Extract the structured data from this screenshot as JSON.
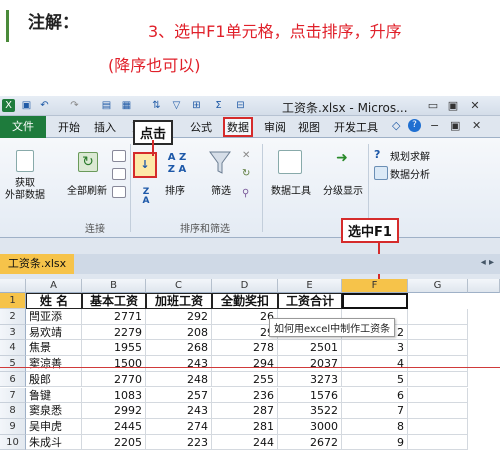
{
  "annotation": {
    "title": "注解：",
    "step_line1": "3、选中F1单元格，点击排序，升序",
    "step_line2": "(降序也可以)"
  },
  "window": {
    "title": "工资条.xlsx - Micros...",
    "controls": [
      "▭",
      "▣",
      "✕"
    ]
  },
  "ribbon_tabs": [
    "开始",
    "插入",
    "页",
    "公式",
    "数据",
    "审阅",
    "视图",
    "开发工具"
  ],
  "file_tab": "文件",
  "ribbon": {
    "groups": {
      "connections": "连接",
      "sort_filter": "排序和筛选"
    },
    "buttons": {
      "get_external": "获取\n外部数据",
      "refresh_all": "全部刷新",
      "sort": "排序",
      "filter": "筛选",
      "data_tools": "数据工具",
      "outline": "分级显示",
      "solver": "规划求解",
      "data_analysis": "数据分析"
    }
  },
  "callouts": {
    "click": "点击",
    "select_f1": "选中F1"
  },
  "workbook_tab": "工资条.xlsx",
  "tooltip": "如何用excel中制作工资条",
  "columns": [
    "A",
    "B",
    "C",
    "D",
    "E",
    "F",
    "G"
  ],
  "header_row": [
    "姓 名",
    "基本工资",
    "加班工资",
    "全勤奖扣",
    "工资合计"
  ],
  "rows": [
    {
      "num": "2",
      "name": "閆亚添",
      "b": "2771",
      "c": "292",
      "d": "26",
      "e": "",
      "f": ""
    },
    {
      "num": "3",
      "name": "易欢靖",
      "b": "2279",
      "c": "208",
      "d": "29",
      "e": "",
      "f": "2"
    },
    {
      "num": "4",
      "name": "焦景",
      "b": "1955",
      "c": "268",
      "d": "278",
      "e": "2501",
      "f": "3"
    },
    {
      "num": "5",
      "name": "窦涼善",
      "b": "1500",
      "c": "243",
      "d": "294",
      "e": "2037",
      "f": "4"
    },
    {
      "num": "6",
      "name": "殷郎",
      "b": "2770",
      "c": "248",
      "d": "255",
      "e": "3273",
      "f": "5"
    },
    {
      "num": "7",
      "name": "鲁键",
      "b": "1083",
      "c": "257",
      "d": "236",
      "e": "1576",
      "f": "6"
    },
    {
      "num": "8",
      "name": "窦泉悉",
      "b": "2992",
      "c": "243",
      "d": "287",
      "e": "3522",
      "f": "7"
    },
    {
      "num": "9",
      "name": "吴申虎",
      "b": "2445",
      "c": "274",
      "d": "281",
      "e": "3000",
      "f": "8"
    },
    {
      "num": "10",
      "name": "朱成斗",
      "b": "2205",
      "c": "223",
      "d": "244",
      "e": "2672",
      "f": "9"
    }
  ]
}
